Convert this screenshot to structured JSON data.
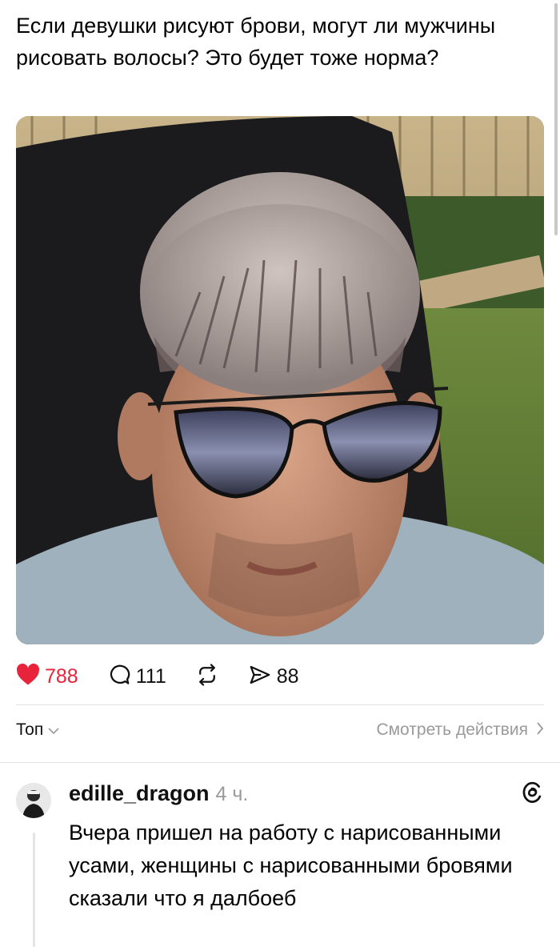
{
  "post": {
    "text": "Если девушки рисуют брови, могут ли мужчины рисовать волосы? Это будет тоже норма?"
  },
  "actions": {
    "likes": "788",
    "comments": "111",
    "shares": "88",
    "like_color": "#e8243c"
  },
  "sort": {
    "label": "Топ"
  },
  "activity_link": {
    "label": "Смотреть действия"
  },
  "comment": {
    "username": "edille_dragon",
    "time": "4 ч.",
    "text": "Вчера пришел на работу с нарисованными усами, женщины с нарисованными бровями сказали что я далбоеб"
  },
  "icons": {
    "like": "heart-icon",
    "comment": "speech-bubble-icon",
    "repost": "repost-icon",
    "share": "send-icon",
    "sort_chevron": "chevron-down-icon",
    "activity_chevron": "chevron-right-icon",
    "threads": "threads-logo-icon"
  }
}
